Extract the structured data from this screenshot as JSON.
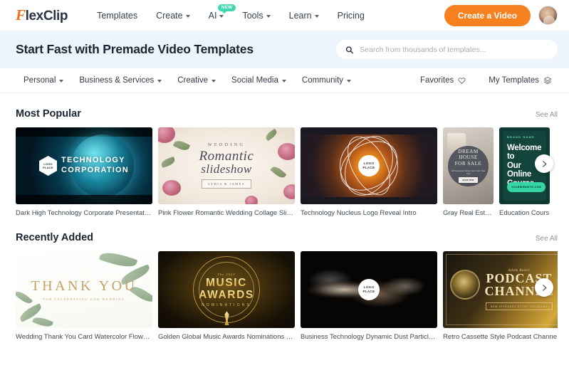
{
  "brand": {
    "logo_f": "F",
    "logo_rest": "lexClip"
  },
  "header": {
    "nav": [
      {
        "label": "Templates",
        "caret": false,
        "badge": null
      },
      {
        "label": "Create",
        "caret": true,
        "badge": null
      },
      {
        "label": "AI",
        "caret": true,
        "badge": "NEW"
      },
      {
        "label": "Tools",
        "caret": true,
        "badge": null
      },
      {
        "label": "Learn",
        "caret": true,
        "badge": null
      },
      {
        "label": "Pricing",
        "caret": false,
        "badge": null
      }
    ],
    "cta_label": "Create a Video",
    "avatar_name": "user-avatar"
  },
  "hero": {
    "title": "Start Fast with Premade Video Templates",
    "search_placeholder": "Search from thousands of templates...",
    "search_value": "",
    "search_icon": "search-icon"
  },
  "categorybar": {
    "items": [
      {
        "label": "Personal"
      },
      {
        "label": "Business & Services"
      },
      {
        "label": "Creative"
      },
      {
        "label": "Social Media"
      },
      {
        "label": "Community"
      }
    ],
    "favorites_label": "Favorites",
    "favorites_icon": "heart-icon",
    "mytemplates_label": "My Templates",
    "mytemplates_icon": "layers-icon"
  },
  "sections": [
    {
      "title": "Most Popular",
      "see_all": "See All",
      "next_icon": "chevron-right-icon",
      "cards": [
        {
          "title": "Dark High Technology Corporate Presentation",
          "art": "tech",
          "art_text": {
            "line1": "TECHNOLOGY",
            "line2": "CORPORATION",
            "badge1": "LOGO",
            "badge2": "PLACE"
          }
        },
        {
          "title": "Pink Flower Romantic Wedding Collage Slideshow",
          "art": "wedding",
          "art_text": {
            "kicker": "WEDDING",
            "line1": "Romantic",
            "line2": "slideshow",
            "tag": "LYDIA & JAMES"
          }
        },
        {
          "title": "Technology Nucleus Logo Reveal Intro",
          "art": "nucleus",
          "art_text": {
            "badge1": "LOGO",
            "badge2": "PLACE"
          }
        },
        {
          "title": "Gray Real Estat...",
          "art": "realestate",
          "art_text": {
            "line1": "DREAM",
            "line2": "HOUSE",
            "line3": "FOR SALE",
            "sub": "128 Roosevelt Street, New York, New York",
            "button": "BOOK NOW"
          }
        },
        {
          "title": "Education Cours",
          "art": "course",
          "art_text": {
            "brand": "BRAND NAME",
            "line1": "Welcome to",
            "line2": "Our Online",
            "line3": "Course",
            "button": "YOURWEBSITE.COM"
          }
        }
      ]
    },
    {
      "title": "Recently Added",
      "see_all": "See All",
      "next_icon": "chevron-right-icon",
      "cards": [
        {
          "title": "Wedding Thank You Card Watercolor Flower Slides...",
          "art": "thankyou",
          "art_text": {
            "line1": "THANK YOU",
            "sub": "FOR CELEBRATING OUR WEDDING"
          }
        },
        {
          "title": "Golden Global Music Awards Nominations Show B...",
          "art": "music",
          "art_text": {
            "kicker": "The 2023",
            "line1": "MUSIC",
            "line2": "AWARDS",
            "sub": "NOMINATIONS"
          }
        },
        {
          "title": "Business Technology Dynamic Dust Particles Collid...",
          "art": "dust",
          "art_text": {
            "badge1": "LOGO",
            "badge2": "PLACE"
          }
        },
        {
          "title": "Retro Cassette Style Podcast Channe",
          "art": "podcast",
          "art_text": {
            "kicker": "Adam Baker",
            "line1": "PODCAST",
            "line2": "CHANNEL",
            "tag": "NEW EPISODES EVERY SATURDAY"
          }
        }
      ]
    }
  ],
  "colors": {
    "accent": "#f7801f",
    "hero_bg": "#eef4fb",
    "badge_new": "#3fd8ae",
    "text_dark": "#1b2430"
  }
}
